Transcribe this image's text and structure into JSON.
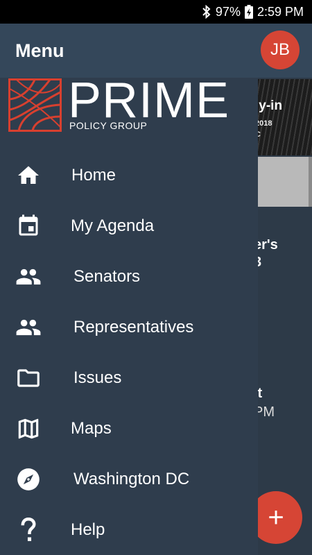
{
  "status_bar": {
    "battery": "97%",
    "time": "2:59 PM"
  },
  "background": {
    "avatar_initials": "JB",
    "card1_title": "ly-in",
    "card1_year": "2018",
    "card1_city": "C",
    "text1_line1": "er's",
    "text1_line2": "3",
    "text2_line1": "lt",
    "text2_line2": "PM",
    "fab_symbol": "+"
  },
  "drawer": {
    "title": "Menu",
    "logo_word": "PRIME",
    "logo_sub": "POLICY GROUP",
    "items": [
      {
        "label": "Home",
        "icon": "home-icon"
      },
      {
        "label": "My Agenda",
        "icon": "calendar-icon"
      },
      {
        "label": "Senators",
        "icon": "people-icon"
      },
      {
        "label": "Representatives",
        "icon": "people-icon"
      },
      {
        "label": "Issues",
        "icon": "folder-icon"
      },
      {
        "label": "Maps",
        "icon": "map-icon"
      },
      {
        "label": "Washington DC",
        "icon": "compass-icon"
      },
      {
        "label": "Help",
        "icon": "help-icon"
      }
    ]
  },
  "colors": {
    "drawer_bg": "#2f3d4d",
    "header_bg": "#34475a",
    "accent": "#d64535",
    "logo_red": "#d8402f"
  }
}
